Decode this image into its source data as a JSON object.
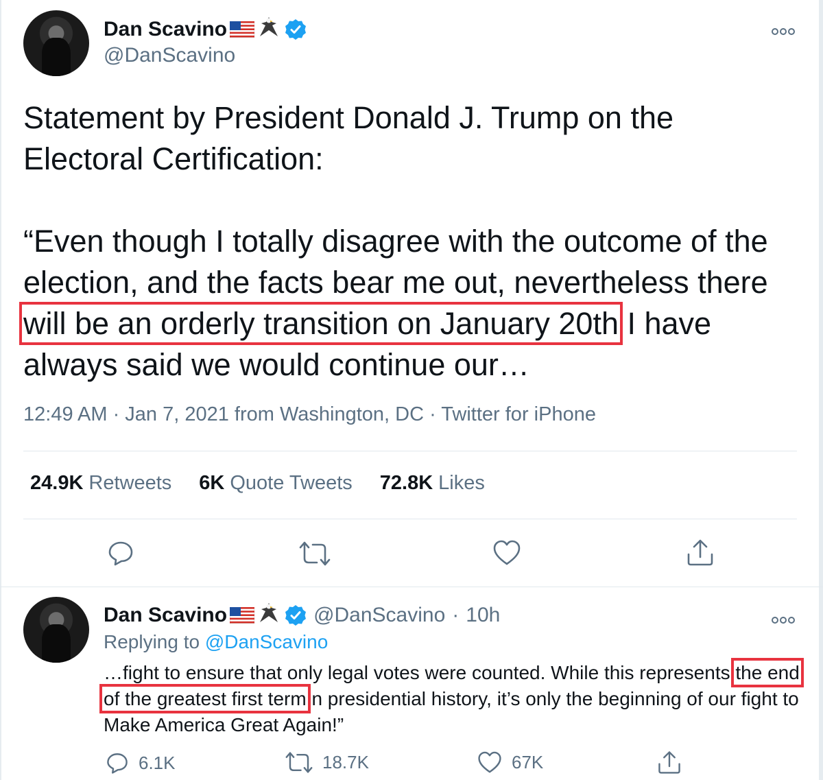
{
  "tweet": {
    "author_name": "Dan Scavino",
    "author_handle": "@DanScavino",
    "text_part1": "Statement by President Donald J. Trump on the Electoral Certification:\n\n“Even though I totally disagree with the outcome of the election, and the facts bear me out, nevertheless there ",
    "text_highlight": "will be an orderly transition on January 20th",
    "text_part2": " I have always said we would continue our…",
    "timestamp": "12:49 AM · Jan 7, 2021 from Washington, DC · Twitter for iPhone",
    "retweets_value": "24.9K",
    "retweets_label": "Retweets",
    "quote_value": "6K",
    "quote_label": "Quote Tweets",
    "likes_value": "72.8K",
    "likes_label": "Likes"
  },
  "reply": {
    "author_name": "Dan Scavino",
    "author_handle": "@DanScavino",
    "separator": "·",
    "time_ago": "10h",
    "replying_prefix": "Replying to",
    "replying_to": "@DanScavino",
    "text_part1": "…fight to ensure that only legal votes were counted. While this represents ",
    "text_highlight": "the end of the greatest first term",
    "text_part2": " n presidential history, it’s only the beginning of our fight to Make America Great Again!”",
    "replies_count": "6.1K",
    "retweets_count": "18.7K",
    "likes_count": "67K"
  },
  "icons": {
    "flag": "us-flag-emoji",
    "eagle": "eagle-emoji",
    "verified": "verified-badge-icon",
    "more": "more-options-icon",
    "reply": "reply-icon",
    "retweet": "retweet-icon",
    "like": "heart-icon",
    "share": "share-icon"
  },
  "colors": {
    "highlight_box": "#e8333f",
    "verified_blue": "#1da1f2",
    "secondary_text": "#5b7083"
  }
}
